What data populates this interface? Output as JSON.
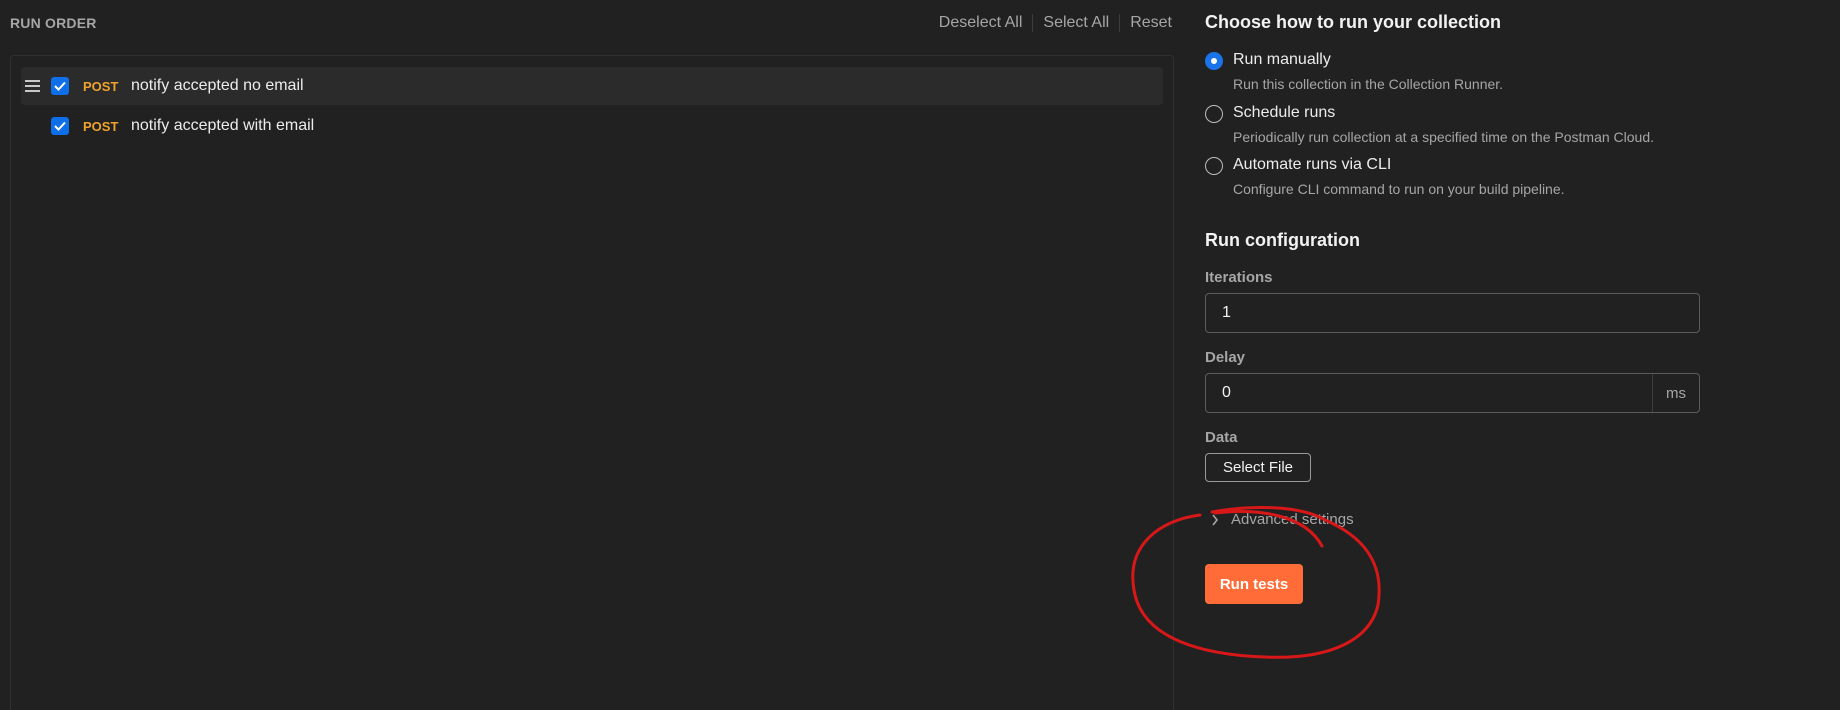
{
  "run_order": {
    "title": "RUN ORDER",
    "deselect_all": "Deselect All",
    "select_all": "Select All",
    "reset": "Reset",
    "requests": [
      {
        "method": "POST",
        "name": "notify accepted no email",
        "checked": true
      },
      {
        "method": "POST",
        "name": "notify accepted with email",
        "checked": true
      }
    ]
  },
  "run_mode": {
    "heading": "Choose how to run your collection",
    "options": [
      {
        "label": "Run manually",
        "description": "Run this collection in the Collection Runner.",
        "selected": true
      },
      {
        "label": "Schedule runs",
        "description": "Periodically run collection at a specified time on the Postman Cloud.",
        "selected": false
      },
      {
        "label": "Automate runs via CLI",
        "description": "Configure CLI command to run on your build pipeline.",
        "selected": false
      }
    ]
  },
  "config": {
    "heading": "Run configuration",
    "iterations_label": "Iterations",
    "iterations_value": "1",
    "delay_label": "Delay",
    "delay_value": "0",
    "delay_unit": "ms",
    "data_label": "Data",
    "select_file": "Select File",
    "advanced": "Advanced settings",
    "run_button": "Run tests"
  },
  "colors": {
    "background": "#212121",
    "method_post": "#f0a32c",
    "checkbox": "#0f6fe8",
    "run_button": "#ff6c37",
    "annotation": "#d81818"
  },
  "icons": {
    "drag": "drag-handle-icon",
    "check": "check-icon",
    "chevron": "chevron-right-icon"
  }
}
